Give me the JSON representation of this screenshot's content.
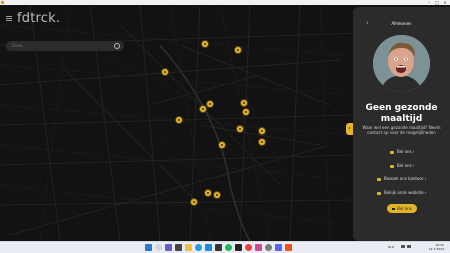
{
  "app": {
    "logo": "fdtrck."
  },
  "titlebar": {
    "minimize": "–",
    "maximize": "□",
    "close": "×"
  },
  "search": {
    "placeholder": "Zoek..."
  },
  "panel": {
    "back_icon": "chevron-left-icon",
    "title": "Afrekenen",
    "heading": "Geen gezonde maaltijd",
    "description": "Waar wel een gezonde maaltijd? Neem contact op voor de mogelijkheden",
    "actions": [
      {
        "label": "Bel ons ›",
        "icon": "phone-icon"
      },
      {
        "label": "Bel ons ›",
        "icon": "phone-icon"
      },
      {
        "label": "Bezoek ons kantoor ›",
        "icon": "location-icon"
      },
      {
        "label": "Bekijk onze website ›",
        "icon": "globe-icon"
      }
    ],
    "cta": "Bel ons"
  },
  "taskbar": {
    "apps": [
      "windows-start-icon",
      "search-icon",
      "chat-icon",
      "task-view-icon",
      "explorer-icon",
      "edge-icon",
      "vscode-icon",
      "store-icon",
      "spotify-icon",
      "terminal-icon",
      "chrome-icon",
      "photos-icon",
      "settings-icon",
      "discord-icon",
      "figma-icon"
    ],
    "tray": {
      "lang": "NLD",
      "time": "16:45",
      "date": "12-7-2023"
    }
  },
  "colors": {
    "accent": "#e3b42a",
    "panel": "#2b2b2b",
    "map": "#121212"
  }
}
